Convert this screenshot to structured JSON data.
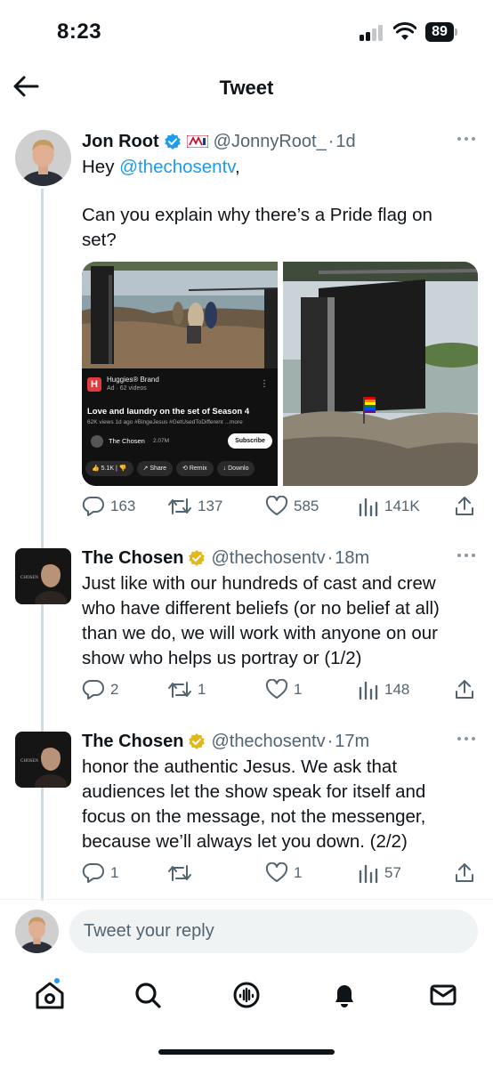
{
  "status_bar": {
    "time": "8:23",
    "battery": "89"
  },
  "header": {
    "title": "Tweet"
  },
  "tweets": [
    {
      "name": "Jon Root",
      "handle": "@JonnyRoot_",
      "time": "1d",
      "mention": "@thechosentv",
      "text_prefix": "Hey ",
      "text_suffix": ",",
      "text_body": "Can you explain why there’s a Pride flag on set?",
      "replies": "163",
      "retweets": "137",
      "likes": "585",
      "views": "141K",
      "verified_color": "#1d9bf0"
    },
    {
      "name": "The Chosen",
      "handle": "@thechosentv",
      "time": "18m",
      "text": "Just like with our hundreds of cast and crew who have different beliefs (or no belief at all) than we do, we will work with anyone on our show who helps us portray or (1/2)",
      "replies": "2",
      "retweets": "1",
      "likes": "1",
      "views": "148",
      "verified_color": "#e2b719"
    },
    {
      "name": "The Chosen",
      "handle": "@thechosentv",
      "time": "17m",
      "text": "honor the authentic Jesus. We ask that audiences let the show speak for itself and focus on the message, not the messenger, because we’ll always let you down. (2/2)",
      "replies": "1",
      "retweets": "",
      "likes": "1",
      "views": "57",
      "verified_color": "#e2b719"
    }
  ],
  "media_card": {
    "brand": "Huggies® Brand",
    "ad_line": "Ad · 62 videos",
    "video_title": "Love and laundry on the set of Season 4",
    "video_meta": "62K views  1d ago  #BingeJesus  #GetUsedToDifferent  ...more",
    "channel": "The Chosen",
    "subscribers": "2.07M",
    "subscribe_label": "Subscribe",
    "like_count": "5.1K",
    "share_label": "Share",
    "remix_label": "Remix",
    "download_label": "Downlo"
  },
  "reply": {
    "placeholder": "Tweet your reply"
  },
  "colors": {
    "accent": "#1d9bf0",
    "muted": "#536471",
    "gold_badge": "#e2b719"
  },
  "icons": [
    "back-arrow-icon",
    "verified-icon",
    "reply-icon",
    "retweet-icon",
    "like-icon",
    "views-icon",
    "share-icon",
    "home-icon",
    "search-icon",
    "spaces-icon",
    "notifications-icon",
    "messages-icon"
  ]
}
